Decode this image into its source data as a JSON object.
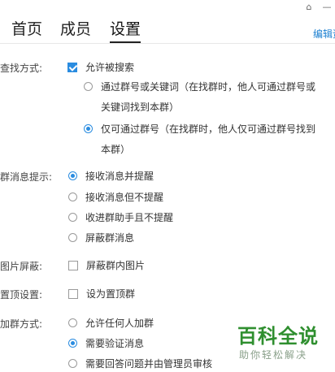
{
  "icons": {
    "home": "home-icon",
    "minimize": "minimize-icon"
  },
  "tabs": [
    {
      "label": "首页",
      "active": false
    },
    {
      "label": "成员",
      "active": false
    },
    {
      "label": "设置",
      "active": true
    }
  ],
  "edit_link": "编辑资",
  "search": {
    "label": "查找方式:",
    "allow": "允许被搜索",
    "option1_line1": "通过群号或关键词（在找群时，他人可通过群号或",
    "option1_line2": "关键词找到本群）",
    "option2_line1": "仅可通过群号（在找群时，他人仅可通过群号找到",
    "option2_line2": "本群）"
  },
  "notify": {
    "label": "群消息提示:",
    "options": [
      "接收消息并提醒",
      "接收消息但不提醒",
      "收进群助手且不提醒",
      "屏蔽群消息"
    ],
    "selected": 0
  },
  "image_block": {
    "label": "图片屏蔽:",
    "option": "屏蔽群内图片"
  },
  "pin": {
    "label": "置顶设置:",
    "option": "设为置顶群"
  },
  "join": {
    "label": "加群方式:",
    "options": [
      "允许任何人加群",
      "需要验证消息",
      "需要回答问题并由管理员审核"
    ],
    "selected": 1
  },
  "watermark": {
    "main": "百科全说",
    "sub": "助你轻松解决"
  },
  "colors": {
    "accent": "#2a8ce0",
    "link": "#1a7fd0",
    "watermark": "#2f8f2f"
  }
}
